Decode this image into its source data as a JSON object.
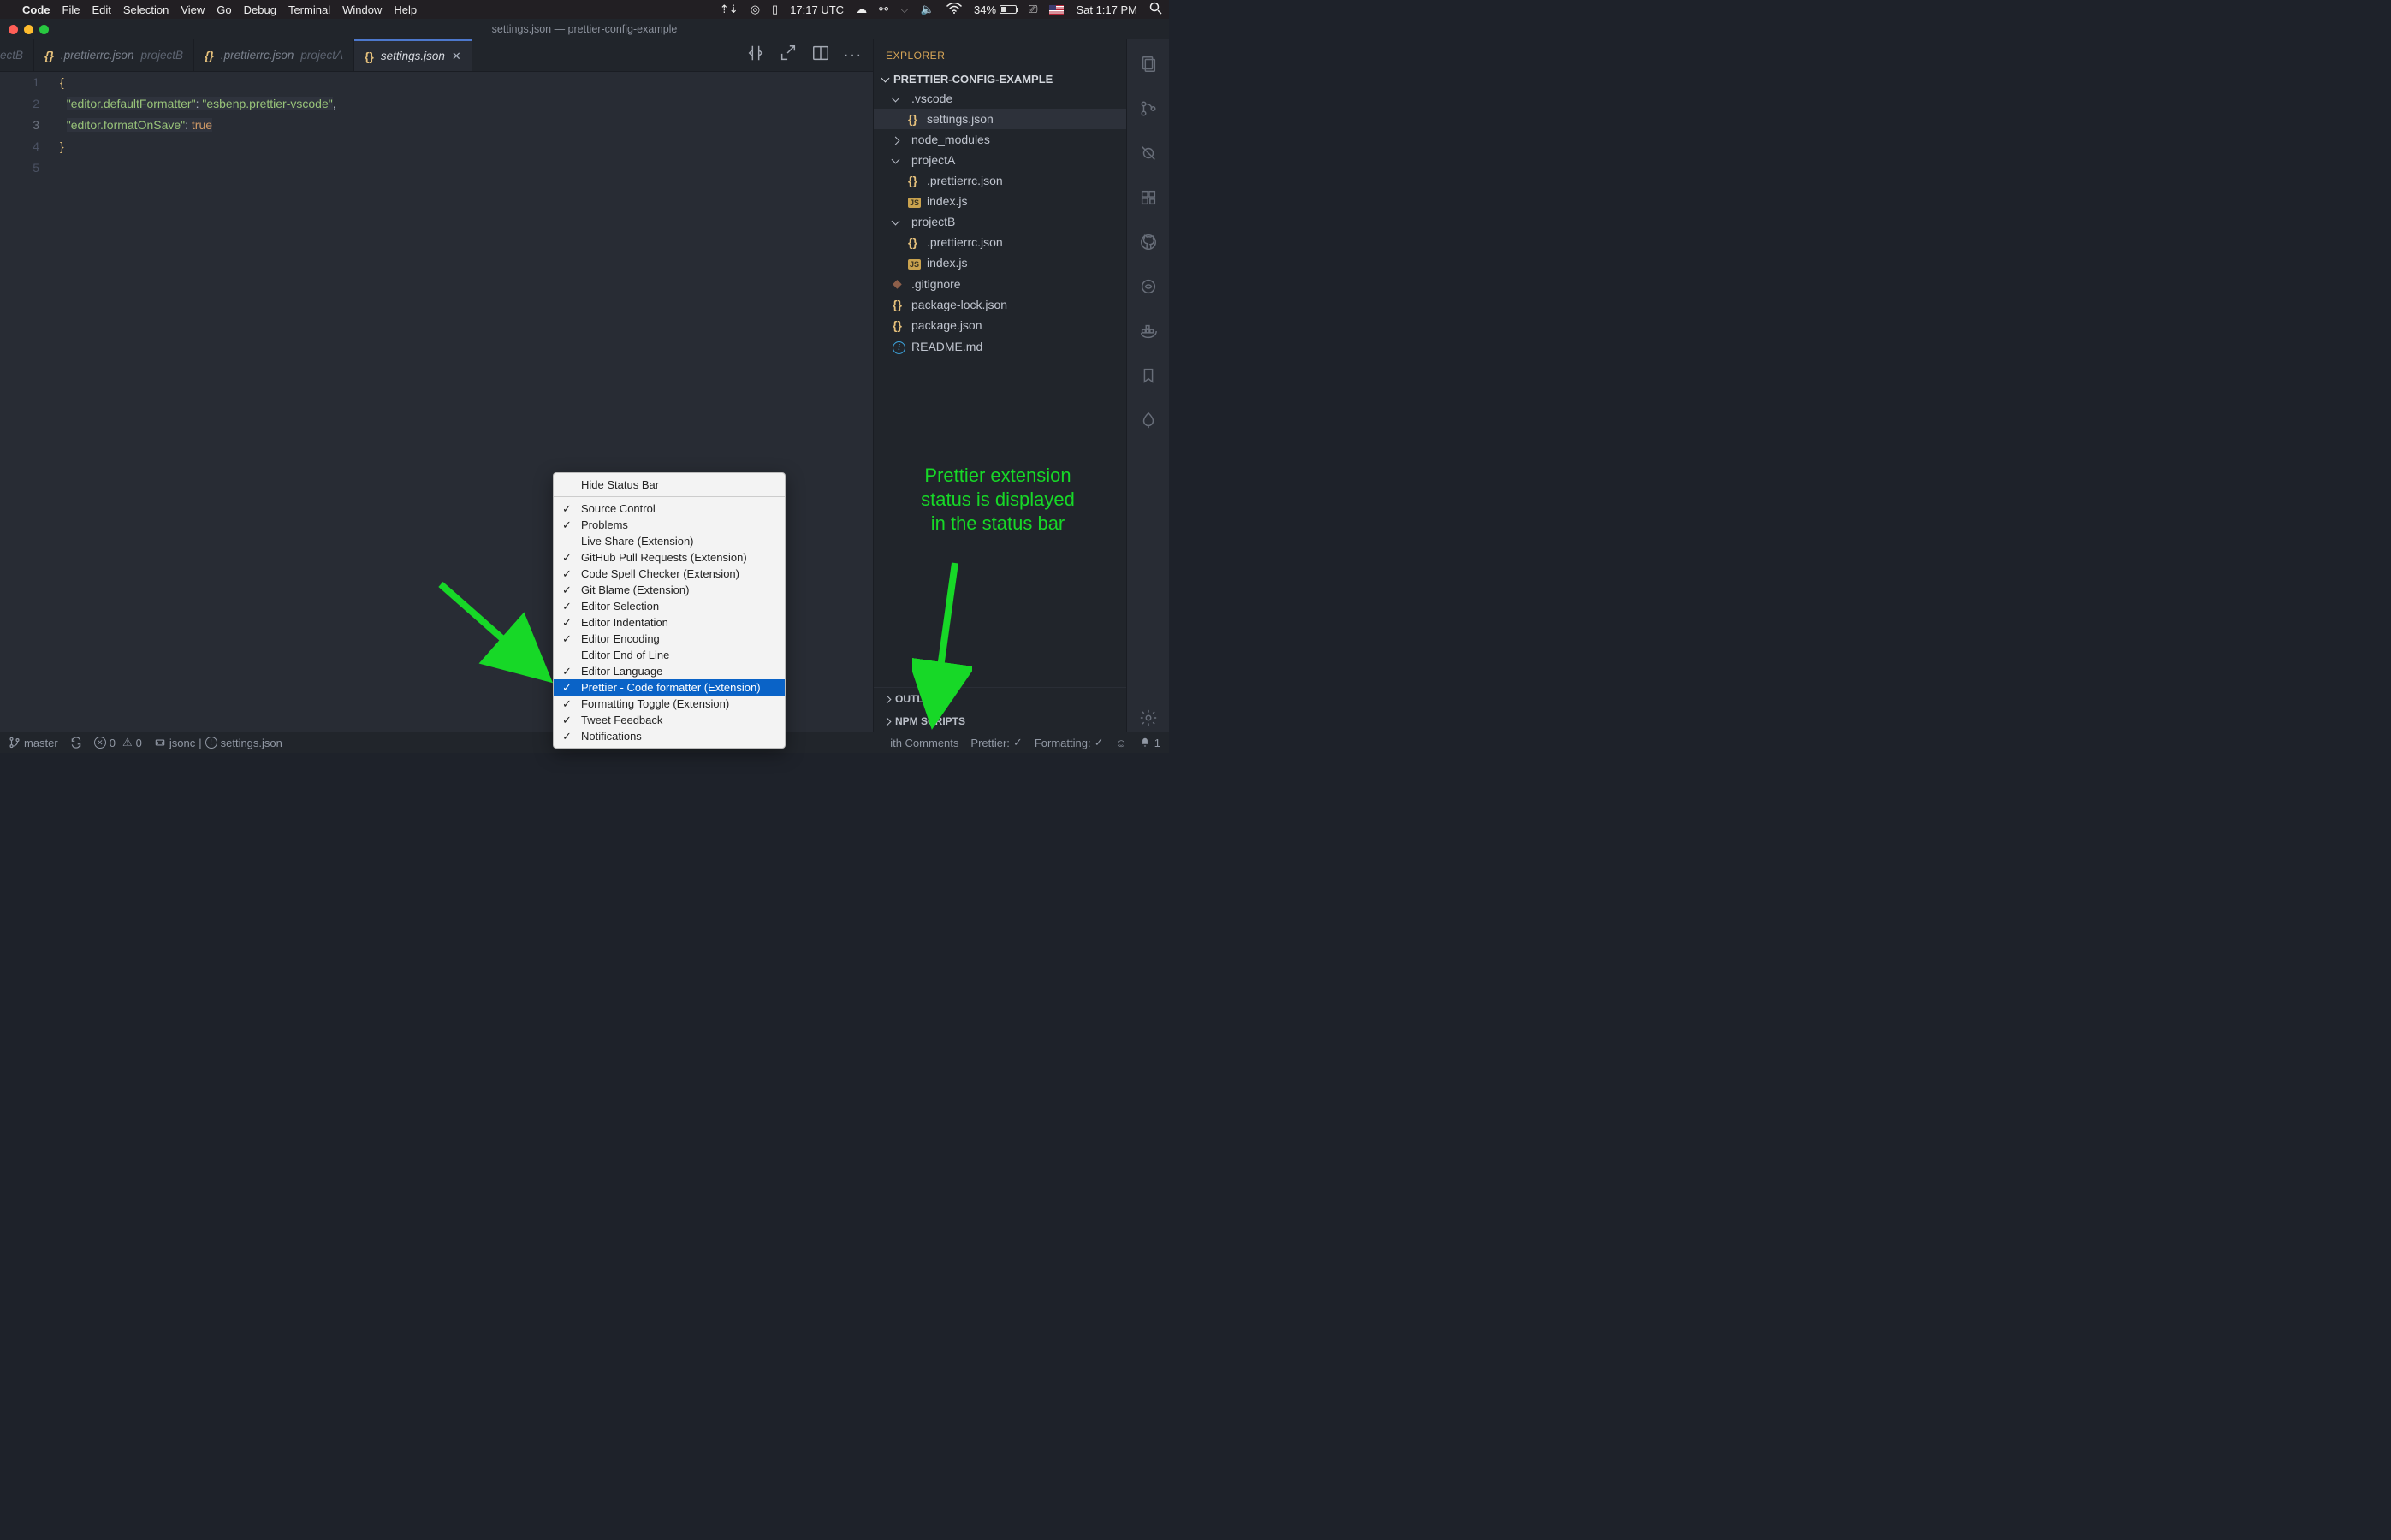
{
  "macos": {
    "app": "Code",
    "menus": [
      "File",
      "Edit",
      "Selection",
      "View",
      "Go",
      "Debug",
      "Terminal",
      "Window",
      "Help"
    ],
    "time_utc": "17:17 UTC",
    "battery_pct": "34%",
    "day_time": "Sat 1:17 PM"
  },
  "window_title": "settings.json — prettier-config-example",
  "tabs": {
    "items": [
      {
        "name": ".prettierrc.json",
        "dir": "projectB",
        "icon": "braces"
      },
      {
        "name": ".prettierrc.json",
        "dir": "projectA",
        "icon": "braces"
      }
    ],
    "active": {
      "name": "settings.json",
      "icon": "braces"
    },
    "cut_prefix": "ectB"
  },
  "editor": {
    "lines": [
      {
        "n": 1,
        "seg": [
          {
            "t": "{",
            "c": "y"
          }
        ]
      },
      {
        "n": 2,
        "seg": [
          {
            "t": "  ",
            "c": "p"
          },
          {
            "t": "\"editor.defaultFormatter\"",
            "c": "g",
            "hl": true
          },
          {
            "t": ": ",
            "c": "p",
            "hl": true
          },
          {
            "t": "\"esbenp.prettier-vscode\"",
            "c": "g",
            "hl": true
          },
          {
            "t": ",",
            "c": "p"
          }
        ]
      },
      {
        "n": 3,
        "seg": [
          {
            "t": "  ",
            "c": "p"
          },
          {
            "t": "\"editor.formatOnSave\"",
            "c": "g",
            "hl": true
          },
          {
            "t": ": ",
            "c": "p",
            "hl": true
          },
          {
            "t": "true",
            "c": "o",
            "hl": true
          }
        ]
      },
      {
        "n": 4,
        "seg": [
          {
            "t": "}",
            "c": "y"
          }
        ]
      },
      {
        "n": 5,
        "seg": []
      }
    ],
    "current_line": 3
  },
  "explorer": {
    "title": "EXPLORER",
    "root": "PRETTIER-CONFIG-EXAMPLE",
    "items": [
      {
        "type": "folder",
        "label": ".vscode",
        "open": true,
        "depth": 1
      },
      {
        "type": "file",
        "label": "settings.json",
        "icon": "braces",
        "selected": true,
        "depth": 2
      },
      {
        "type": "folder",
        "label": "node_modules",
        "open": false,
        "depth": 1
      },
      {
        "type": "folder",
        "label": "projectA",
        "open": true,
        "depth": 1
      },
      {
        "type": "file",
        "label": ".prettierrc.json",
        "icon": "braces",
        "depth": 2
      },
      {
        "type": "file",
        "label": "index.js",
        "icon": "js",
        "depth": 2
      },
      {
        "type": "folder",
        "label": "projectB",
        "open": true,
        "depth": 1
      },
      {
        "type": "file",
        "label": ".prettierrc.json",
        "icon": "braces",
        "depth": 2
      },
      {
        "type": "file",
        "label": "index.js",
        "icon": "js",
        "depth": 2
      },
      {
        "type": "file",
        "label": ".gitignore",
        "icon": "git",
        "depth": 1
      },
      {
        "type": "file",
        "label": "package-lock.json",
        "icon": "braces",
        "depth": 1
      },
      {
        "type": "file",
        "label": "package.json",
        "icon": "braces",
        "depth": 1
      },
      {
        "type": "file",
        "label": "README.md",
        "icon": "info",
        "depth": 1
      }
    ],
    "sections": [
      "OUTLINE",
      "NPM SCRIPTS"
    ]
  },
  "status": {
    "branch": "master",
    "errors": "0",
    "warnings": "0",
    "lang_left": "jsonc",
    "file_info": "settings.json",
    "lang_right_partial": "ith Comments",
    "prettier": "Prettier:",
    "formatting": "Formatting:",
    "notif": "1"
  },
  "context_menu": {
    "header": "Hide Status Bar",
    "items": [
      {
        "label": "Source Control",
        "checked": true
      },
      {
        "label": "Problems",
        "checked": true
      },
      {
        "label": "Live Share (Extension)",
        "checked": false
      },
      {
        "label": "GitHub Pull Requests (Extension)",
        "checked": true
      },
      {
        "label": "Code Spell Checker (Extension)",
        "checked": true
      },
      {
        "label": "Git Blame (Extension)",
        "checked": true
      },
      {
        "label": "Editor Selection",
        "checked": true
      },
      {
        "label": "Editor Indentation",
        "checked": true
      },
      {
        "label": "Editor Encoding",
        "checked": true
      },
      {
        "label": "Editor End of Line",
        "checked": false
      },
      {
        "label": "Editor Language",
        "checked": true
      },
      {
        "label": "Prettier - Code formatter (Extension)",
        "checked": true,
        "selected": true
      },
      {
        "label": "Formatting Toggle (Extension)",
        "checked": true
      },
      {
        "label": "Tweet Feedback",
        "checked": true
      },
      {
        "label": "Notifications",
        "checked": true
      }
    ]
  },
  "annotation": {
    "line1": "Prettier extension",
    "line2": "status is displayed",
    "line3": "in the status bar"
  }
}
